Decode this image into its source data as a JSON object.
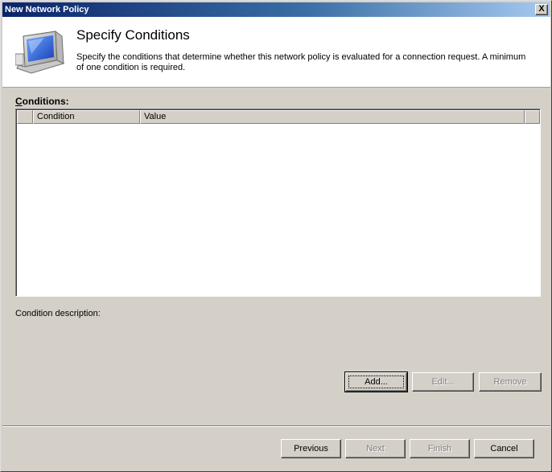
{
  "window": {
    "title": "New Network Policy",
    "close_glyph": "X"
  },
  "header": {
    "title": "Specify Conditions",
    "description": "Specify the conditions that determine whether this network policy is evaluated for a connection request. A minimum of one condition is required.",
    "icon": "network-monitor-icon"
  },
  "conditions": {
    "label_prefix": "C",
    "label_rest": "onditions:",
    "columns": [
      "",
      "Condition",
      "Value",
      ""
    ],
    "rows": []
  },
  "condition_description": {
    "label": "Condition description:"
  },
  "actions": {
    "add": "Add...",
    "edit": "Edit...",
    "remove": "Remove"
  },
  "footer": {
    "previous": "Previous",
    "next": "Next",
    "finish": "Finish",
    "cancel": "Cancel"
  },
  "colors": {
    "titlebar_start": "#0a246a",
    "titlebar_end": "#a6caf0",
    "face": "#d4d0c8",
    "disabled_text": "#808080"
  }
}
